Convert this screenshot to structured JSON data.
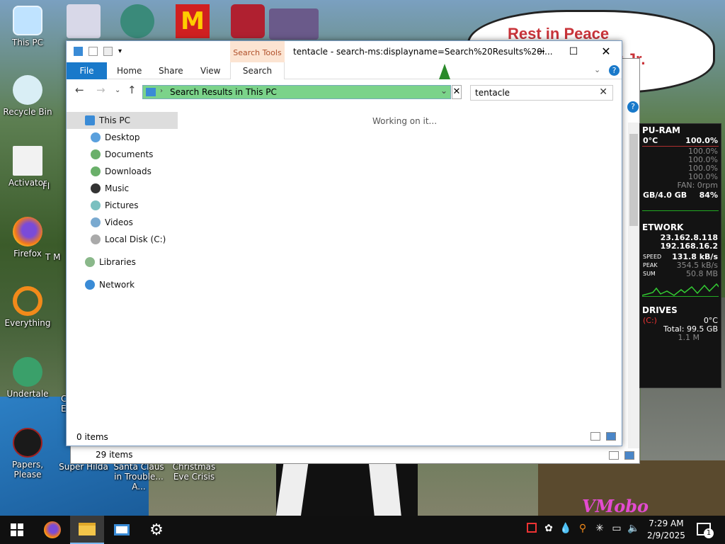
{
  "desktop": {
    "icons": [
      {
        "label": "This PC"
      },
      {
        "label": "Recycle Bin"
      },
      {
        "label": "Activator"
      },
      {
        "label": "Fl"
      },
      {
        "label": "Firefox"
      },
      {
        "label": "T M"
      },
      {
        "label": "Everything"
      },
      {
        "label": "Undertale"
      },
      {
        "label": "C E"
      },
      {
        "label": "Papers, Please"
      },
      {
        "label": "Super Hilda"
      },
      {
        "label": "Santa Claus in Trouble... A..."
      },
      {
        "label": "Christmas Eve Crisis"
      }
    ],
    "speech_line1": "Rest in Peace",
    "speech_line2": "rter Jr.",
    "watermark": "VMobo"
  },
  "widget": {
    "cpu_title": "PU-RAM",
    "cpu_temp": "0°C",
    "cpu_load": "100.0%",
    "cores": [
      "100.0%",
      "100.0%",
      "100.0%",
      "100.0%"
    ],
    "fan": "FAN: 0rpm",
    "ram": "GB/4.0 GB",
    "ram_pct": "84%",
    "net_title": "ETWORK",
    "ip1": "23.162.8.118",
    "ip2": "192.168.16.2",
    "speed_label": "SPEED",
    "speed": "131.8 kB/s",
    "peak_label": "PEAK",
    "peak": "354.5 kB/s",
    "sum_label": "SUM",
    "sum": "50.8 MB",
    "drives_title": "DRIVES",
    "drive": "(C:)",
    "drive_temp": "0°C",
    "total": "Total: 99.5 GB",
    "used": "1.1 M"
  },
  "explorer": {
    "context_tab": "Search Tools",
    "title": "tentacle - search-ms:displayname=Search%20Results%20i...",
    "tabs": [
      "File",
      "Home",
      "Share",
      "View",
      "Search"
    ],
    "address": "Search Results in This PC",
    "search_value": "tentacle",
    "tree": [
      {
        "label": "This PC"
      },
      {
        "label": "Desktop"
      },
      {
        "label": "Documents"
      },
      {
        "label": "Downloads"
      },
      {
        "label": "Music"
      },
      {
        "label": "Pictures"
      },
      {
        "label": "Videos"
      },
      {
        "label": "Local Disk (C:)"
      },
      {
        "label": "Libraries"
      },
      {
        "label": "Network"
      }
    ],
    "working": "Working on it...",
    "status": "0 items"
  },
  "back_window": {
    "status": "29 items"
  },
  "taskbar": {
    "time": "7:29 AM",
    "date": "2/9/2025",
    "notifications": "1"
  },
  "colors": {
    "accent": "#1979ca",
    "address_bg": "#7bd38a",
    "context_tab_bg": "#fce4d2"
  }
}
